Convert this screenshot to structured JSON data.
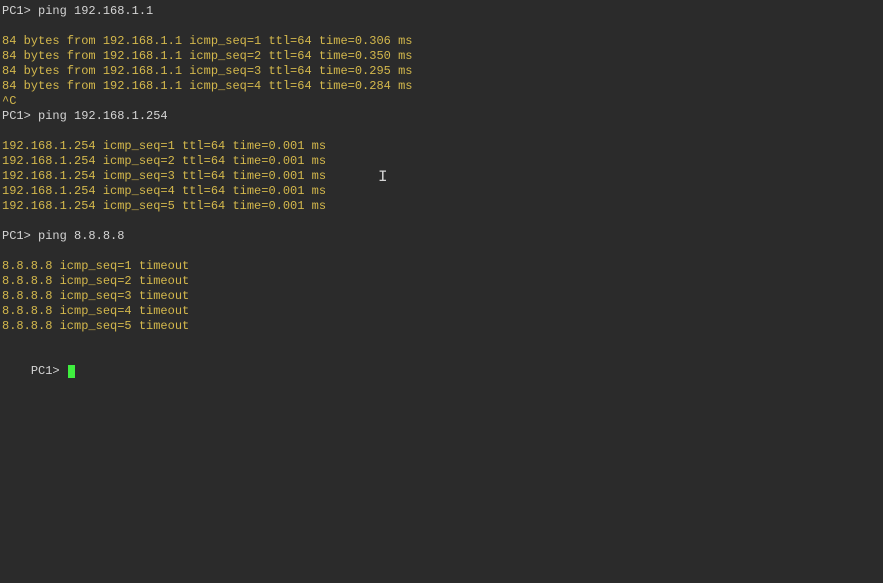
{
  "lines": [
    {
      "type": "prompt",
      "text": "PC1> ping 192.168.1.1"
    },
    {
      "type": "blank"
    },
    {
      "type": "output",
      "text": "84 bytes from 192.168.1.1 icmp_seq=1 ttl=64 time=0.306 ms"
    },
    {
      "type": "output",
      "text": "84 bytes from 192.168.1.1 icmp_seq=2 ttl=64 time=0.350 ms"
    },
    {
      "type": "output",
      "text": "84 bytes from 192.168.1.1 icmp_seq=3 ttl=64 time=0.295 ms"
    },
    {
      "type": "output",
      "text": "84 bytes from 192.168.1.1 icmp_seq=4 ttl=64 time=0.284 ms"
    },
    {
      "type": "output",
      "text": "^C"
    },
    {
      "type": "prompt",
      "text": "PC1> ping 192.168.1.254"
    },
    {
      "type": "blank"
    },
    {
      "type": "output",
      "text": "192.168.1.254 icmp_seq=1 ttl=64 time=0.001 ms"
    },
    {
      "type": "output",
      "text": "192.168.1.254 icmp_seq=2 ttl=64 time=0.001 ms"
    },
    {
      "type": "output",
      "text": "192.168.1.254 icmp_seq=3 ttl=64 time=0.001 ms"
    },
    {
      "type": "output",
      "text": "192.168.1.254 icmp_seq=4 ttl=64 time=0.001 ms"
    },
    {
      "type": "output",
      "text": "192.168.1.254 icmp_seq=5 ttl=64 time=0.001 ms"
    },
    {
      "type": "blank"
    },
    {
      "type": "prompt",
      "text": "PC1> ping 8.8.8.8"
    },
    {
      "type": "blank"
    },
    {
      "type": "output",
      "text": "8.8.8.8 icmp_seq=1 timeout"
    },
    {
      "type": "output",
      "text": "8.8.8.8 icmp_seq=2 timeout"
    },
    {
      "type": "output",
      "text": "8.8.8.8 icmp_seq=3 timeout"
    },
    {
      "type": "output",
      "text": "8.8.8.8 icmp_seq=4 timeout"
    },
    {
      "type": "output",
      "text": "8.8.8.8 icmp_seq=5 timeout"
    },
    {
      "type": "blank"
    }
  ],
  "current_prompt": "PC1> ",
  "text_cursor_glyph": "I"
}
